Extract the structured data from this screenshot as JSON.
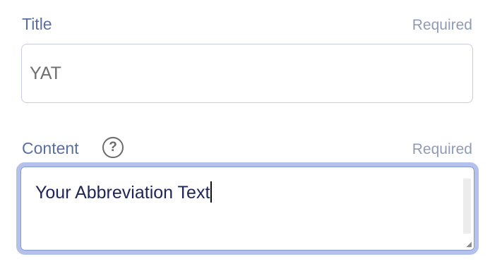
{
  "title_field": {
    "label": "Title",
    "required_text": "Required",
    "value": "YAT"
  },
  "content_field": {
    "label": "Content",
    "required_text": "Required",
    "help_icon": "question-circle-icon",
    "value": "Your Abbreviation Text"
  },
  "colors": {
    "label": "#5b6f9e",
    "required": "#8f9bb6",
    "focus_ring": "#b4c1ea",
    "content_text": "#1f2657"
  }
}
